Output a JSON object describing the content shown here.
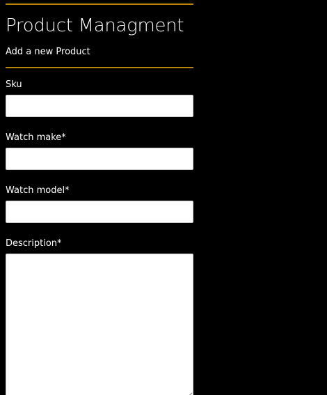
{
  "header": {
    "title": "Product Managment",
    "subtitle": "Add a new Product"
  },
  "colors": {
    "background": "#000000",
    "accent_rule": "#b8860b",
    "text": "#ffffff",
    "input_background": "#ffffff"
  },
  "form": {
    "sku": {
      "label": "Sku",
      "value": ""
    },
    "watch_make": {
      "label": "Watch make*",
      "value": ""
    },
    "watch_model": {
      "label": "Watch model*",
      "value": ""
    },
    "description": {
      "label": "Description*",
      "value": ""
    }
  }
}
